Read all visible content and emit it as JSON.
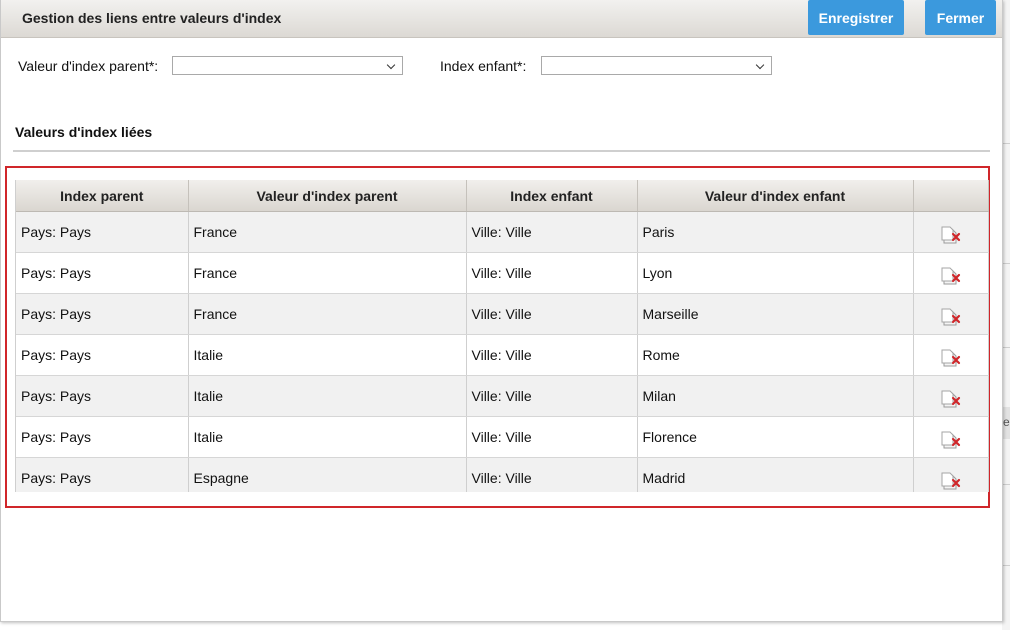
{
  "dialog": {
    "title": "Gestion des liens entre valeurs d'index",
    "save_label": "Enregistrer",
    "close_label": "Fermer"
  },
  "form": {
    "parent_value_label": "Valeur d'index parent*:",
    "parent_value_selected": "",
    "child_index_label": "Index enfant*:",
    "child_index_selected": ""
  },
  "section": {
    "title": "Valeurs d'index liées"
  },
  "table": {
    "headers": [
      "Index parent",
      "Valeur d'index parent",
      "Index enfant",
      "Valeur d'index enfant",
      ""
    ],
    "rows": [
      {
        "parent_index": "Pays: Pays",
        "parent_value": "France",
        "child_index": "Ville: Ville",
        "child_value": "Paris"
      },
      {
        "parent_index": "Pays: Pays",
        "parent_value": "France",
        "child_index": "Ville: Ville",
        "child_value": "Lyon"
      },
      {
        "parent_index": "Pays: Pays",
        "parent_value": "France",
        "child_index": "Ville: Ville",
        "child_value": "Marseille"
      },
      {
        "parent_index": "Pays: Pays",
        "parent_value": "Italie",
        "child_index": "Ville: Ville",
        "child_value": "Rome"
      },
      {
        "parent_index": "Pays: Pays",
        "parent_value": "Italie",
        "child_index": "Ville: Ville",
        "child_value": "Milan"
      },
      {
        "parent_index": "Pays: Pays",
        "parent_value": "Italie",
        "child_index": "Ville: Ville",
        "child_value": "Florence"
      },
      {
        "parent_index": "Pays: Pays",
        "parent_value": "Espagne",
        "child_index": "Ville: Ville",
        "child_value": "Madrid"
      }
    ],
    "row_action_icon": "delete-document-icon"
  },
  "backdrop": {
    "partial_char": "e"
  },
  "colors": {
    "button": "#3b99dd",
    "highlight_border": "#d0262a",
    "delete_mark": "#d0262a"
  }
}
